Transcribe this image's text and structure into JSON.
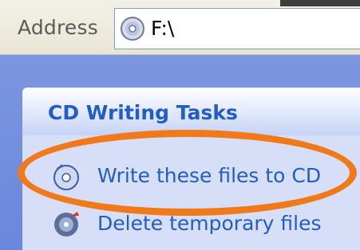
{
  "address_bar": {
    "label": "Address",
    "value": "F:\\",
    "icon": "cd-drive-icon"
  },
  "tasks_panel": {
    "title": "CD Writing Tasks",
    "items": [
      {
        "label": "Write these files to CD",
        "icon": "write-cd-icon"
      },
      {
        "label": "Delete temporary files",
        "icon": "delete-files-icon"
      }
    ]
  },
  "colors": {
    "link_blue": "#215dc6",
    "pane_blue": "#7c96e0",
    "highlight_orange": "#f07a1a"
  }
}
